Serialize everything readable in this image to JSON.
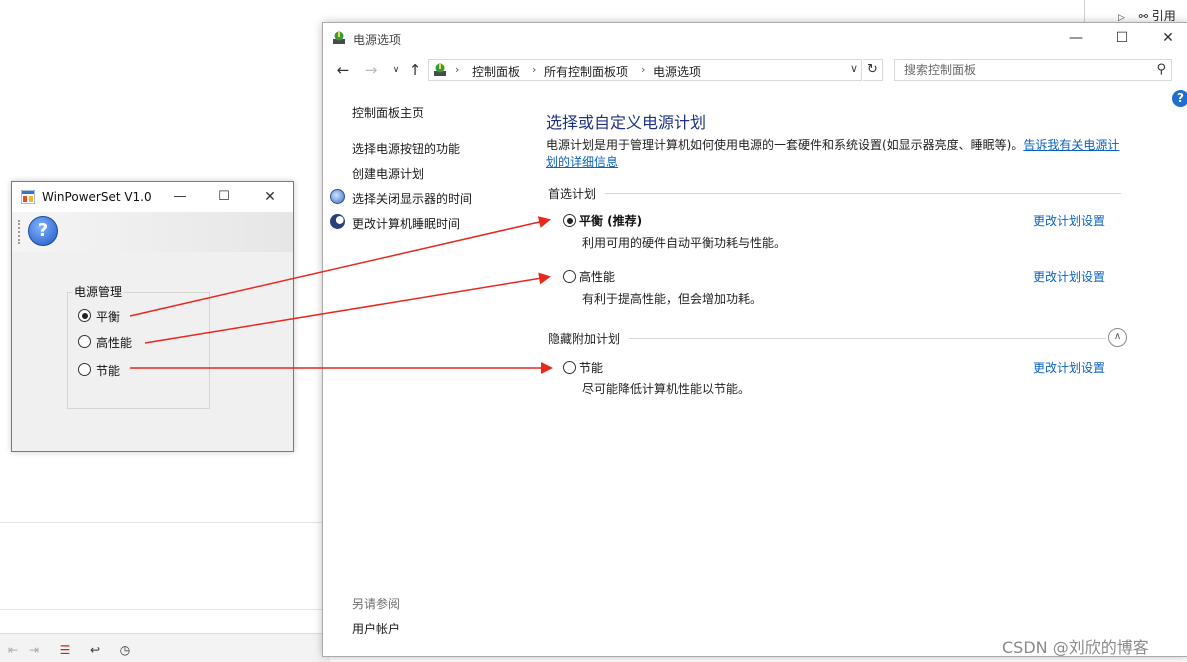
{
  "ide": {
    "tree_item_label": "引用"
  },
  "power_options": {
    "window_title": "电源选项",
    "breadcrumbs": [
      "控制面板",
      "所有控制面板项",
      "电源选项"
    ],
    "search_placeholder": "搜索控制面板",
    "sidebar": {
      "home": "控制面板主页",
      "links": [
        "选择电源按钮的功能",
        "创建电源计划",
        "选择关闭显示器的时间",
        "更改计算机睡眠时间"
      ],
      "see_also_title": "另请参阅",
      "see_also_link": "用户帐户"
    },
    "main": {
      "title": "选择或自定义电源计划",
      "description": "电源计划是用于管理计算机如何使用电源的一套硬件和系统设置(如显示器亮度、睡眠等)。",
      "description_link": "告诉我有关电源计划的详细信息",
      "preferred_header": "首选计划",
      "hidden_header": "隐藏附加计划",
      "change_link": "更改计划设置",
      "plans": [
        {
          "name": "平衡 (推荐)",
          "desc": "利用可用的硬件自动平衡功耗与性能。",
          "selected": true
        },
        {
          "name": "高性能",
          "desc": "有利于提高性能，但会增加功耗。",
          "selected": false
        },
        {
          "name": "节能",
          "desc": "尽可能降低计算机性能以节能。",
          "selected": false
        }
      ]
    }
  },
  "winpowerset": {
    "window_title": "WinPowerSet V1.0",
    "group_label": "电源管理",
    "options": [
      {
        "label": "平衡",
        "selected": true
      },
      {
        "label": "高性能",
        "selected": false
      },
      {
        "label": "节能",
        "selected": false
      }
    ]
  },
  "watermark": "CSDN @刘欣的博客",
  "colors": {
    "arrow": "#e8281e",
    "link": "#0b62c4",
    "title": "#1e3287"
  }
}
